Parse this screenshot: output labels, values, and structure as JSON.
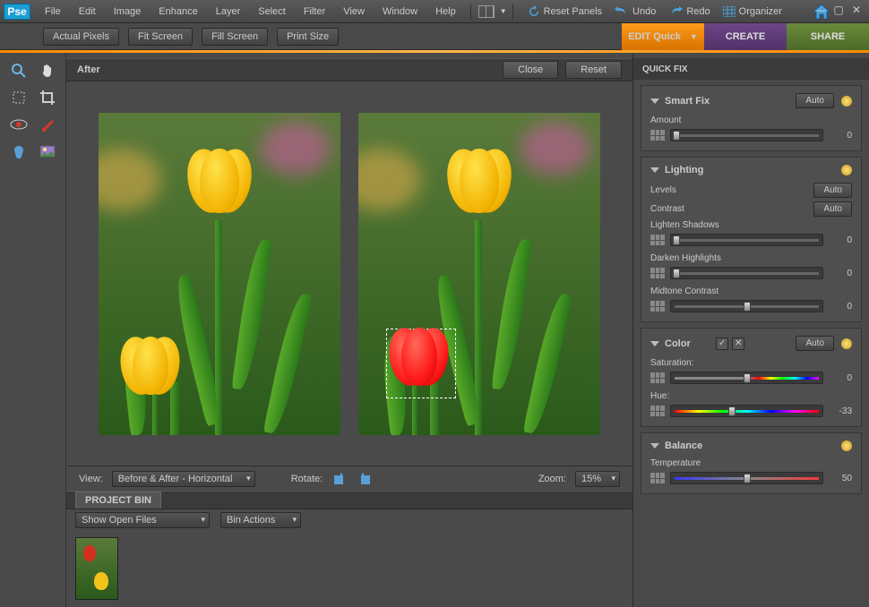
{
  "app": {
    "logo": "Pse"
  },
  "menu": [
    "File",
    "Edit",
    "Image",
    "Enhance",
    "Layer",
    "Select",
    "Filter",
    "View",
    "Window",
    "Help"
  ],
  "topActions": {
    "reset": "Reset Panels",
    "undo": "Undo",
    "redo": "Redo",
    "organizer": "Organizer"
  },
  "options": [
    "Actual Pixels",
    "Fit Screen",
    "Fill Screen",
    "Print Size"
  ],
  "modes": {
    "edit": "EDIT Quick",
    "create": "CREATE",
    "share": "SHARE"
  },
  "preview": {
    "title": "After",
    "close": "Close",
    "reset": "Reset",
    "viewLabel": "View:",
    "viewValue": "Before & After - Horizontal",
    "rotateLabel": "Rotate:",
    "zoomLabel": "Zoom:",
    "zoomValue": "15%"
  },
  "projectBin": {
    "tab": "PROJECT BIN",
    "show": "Show Open Files",
    "actions": "Bin Actions"
  },
  "quickFix": {
    "tab": "QUICK FIX",
    "smartFix": {
      "title": "Smart Fix",
      "auto": "Auto",
      "amount": "Amount",
      "value": "0"
    },
    "lighting": {
      "title": "Lighting",
      "levels": "Levels",
      "contrast": "Contrast",
      "auto": "Auto",
      "lighten": "Lighten Shadows",
      "lightenVal": "0",
      "darken": "Darken Highlights",
      "darkenVal": "0",
      "midtone": "Midtone Contrast",
      "midtoneVal": "0"
    },
    "color": {
      "title": "Color",
      "auto": "Auto",
      "sat": "Saturation:",
      "satVal": "0",
      "hue": "Hue:",
      "hueVal": "-33"
    },
    "balance": {
      "title": "Balance",
      "temp": "Temperature",
      "tempVal": "50"
    }
  },
  "tools": [
    "zoom",
    "hand",
    "marquee",
    "crop",
    "red-eye",
    "brush",
    "bucket",
    "photo"
  ]
}
